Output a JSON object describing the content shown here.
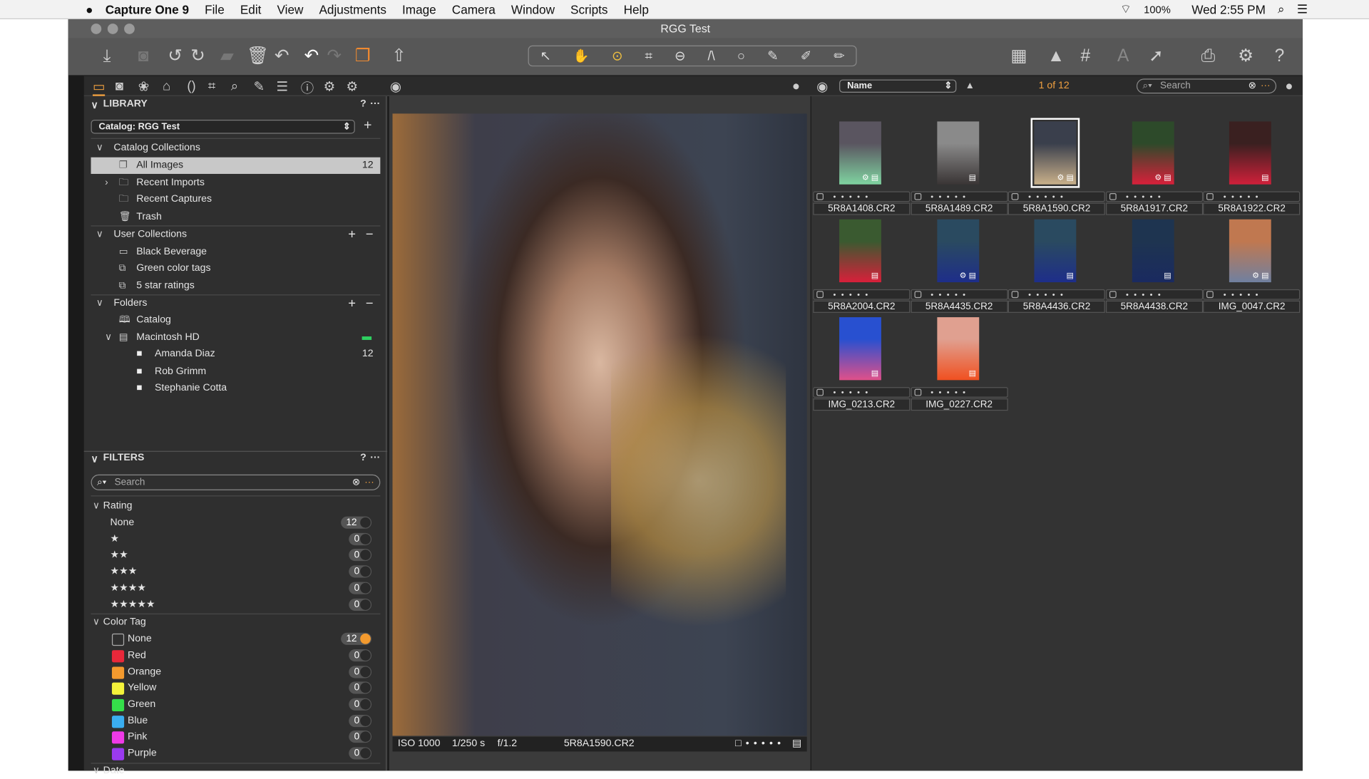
{
  "menubar": {
    "apple_icon": "apple-logo",
    "app": "Capture One 9",
    "items": [
      "File",
      "Edit",
      "View",
      "Adjustments",
      "Image",
      "Camera",
      "Window",
      "Scripts",
      "Help"
    ],
    "battery": "100%",
    "clock": "Wed 2:55 PM"
  },
  "window": {
    "title": "RGG Test"
  },
  "browser_header": {
    "sort": "Name",
    "count": "1 of 12",
    "search_placeholder": "Search"
  },
  "library": {
    "title": "LIBRARY",
    "help": "?",
    "more": "···",
    "catalog": "Catalog: RGG Test",
    "catalog_collections": {
      "label": "Catalog Collections",
      "items": [
        {
          "label": "All Images",
          "count": "12"
        },
        {
          "label": "Recent Imports"
        },
        {
          "label": "Recent Captures"
        },
        {
          "label": "Trash"
        }
      ]
    },
    "user_collections": {
      "label": "User Collections",
      "items": [
        "Black Beverage",
        "Green color tags",
        "5 star ratings"
      ]
    },
    "folders": {
      "label": "Folders",
      "items": [
        {
          "label": "Catalog"
        },
        {
          "label": "Macintosh HD"
        },
        {
          "label": "Amanda Diaz",
          "count": "12"
        },
        {
          "label": "Rob Grimm"
        },
        {
          "label": "Stephanie Cotta"
        }
      ]
    }
  },
  "filters": {
    "title": "FILTERS",
    "help": "?",
    "more": "···",
    "search_placeholder": "Search",
    "rating": {
      "label": "Rating",
      "items": [
        {
          "label": "None",
          "count": "12"
        },
        {
          "label": "★",
          "count": "0"
        },
        {
          "label": "★★",
          "count": "0"
        },
        {
          "label": "★★★",
          "count": "0"
        },
        {
          "label": "★★★★",
          "count": "0"
        },
        {
          "label": "★★★★★",
          "count": "0"
        }
      ]
    },
    "color_tag": {
      "label": "Color Tag",
      "items": [
        {
          "label": "None",
          "count": "12",
          "color": ""
        },
        {
          "label": "Red",
          "count": "0",
          "color": "#e8283a"
        },
        {
          "label": "Orange",
          "count": "0",
          "color": "#f39a2e"
        },
        {
          "label": "Yellow",
          "count": "0",
          "color": "#f4f23a"
        },
        {
          "label": "Green",
          "count": "0",
          "color": "#35e04a"
        },
        {
          "label": "Blue",
          "count": "0",
          "color": "#3aaef0"
        },
        {
          "label": "Pink",
          "count": "0",
          "color": "#f03ae8"
        },
        {
          "label": "Purple",
          "count": "0",
          "color": "#9a3af0"
        }
      ]
    },
    "date": {
      "label": "Date"
    }
  },
  "viewer": {
    "iso": "ISO 1000",
    "shutter": "1/250 s",
    "aperture": "f/1.2",
    "filename": "5R8A1590.CR2"
  },
  "thumbnails": [
    {
      "name": "5R8A1408.CR2",
      "colors": [
        "#5a5560",
        "#7fd3a0"
      ],
      "adjusted": true
    },
    {
      "name": "5R8A1489.CR2",
      "colors": [
        "#8a8a8a",
        "#3a3535"
      ],
      "adjusted": false
    },
    {
      "name": "5R8A1590.CR2",
      "colors": [
        "#3a3f4c",
        "#c9b08a"
      ],
      "adjusted": true,
      "selected": true
    },
    {
      "name": "5R8A1917.CR2",
      "colors": [
        "#2d4a2a",
        "#d8203a"
      ],
      "adjusted": true
    },
    {
      "name": "5R8A1922.CR2",
      "colors": [
        "#3a2020",
        "#d0203a"
      ],
      "adjusted": false
    },
    {
      "name": "5R8A2004.CR2",
      "colors": [
        "#3a5a30",
        "#d8203a"
      ],
      "adjusted": false
    },
    {
      "name": "5R8A4435.CR2",
      "colors": [
        "#2a4a60",
        "#1e2e8a"
      ],
      "adjusted": true
    },
    {
      "name": "5R8A4436.CR2",
      "colors": [
        "#2a4a60",
        "#1e2e8a"
      ],
      "adjusted": false
    },
    {
      "name": "5R8A4438.CR2",
      "colors": [
        "#1e3450",
        "#1a2a60"
      ],
      "adjusted": false
    },
    {
      "name": "IMG_0047.CR2",
      "colors": [
        "#c07850",
        "#7080a0"
      ],
      "adjusted": true
    },
    {
      "name": "IMG_0213.CR2",
      "colors": [
        "#2850d0",
        "#e0508a"
      ],
      "adjusted": false
    },
    {
      "name": "IMG_0227.CR2",
      "colors": [
        "#e0a090",
        "#f05020"
      ],
      "adjusted": false
    }
  ]
}
